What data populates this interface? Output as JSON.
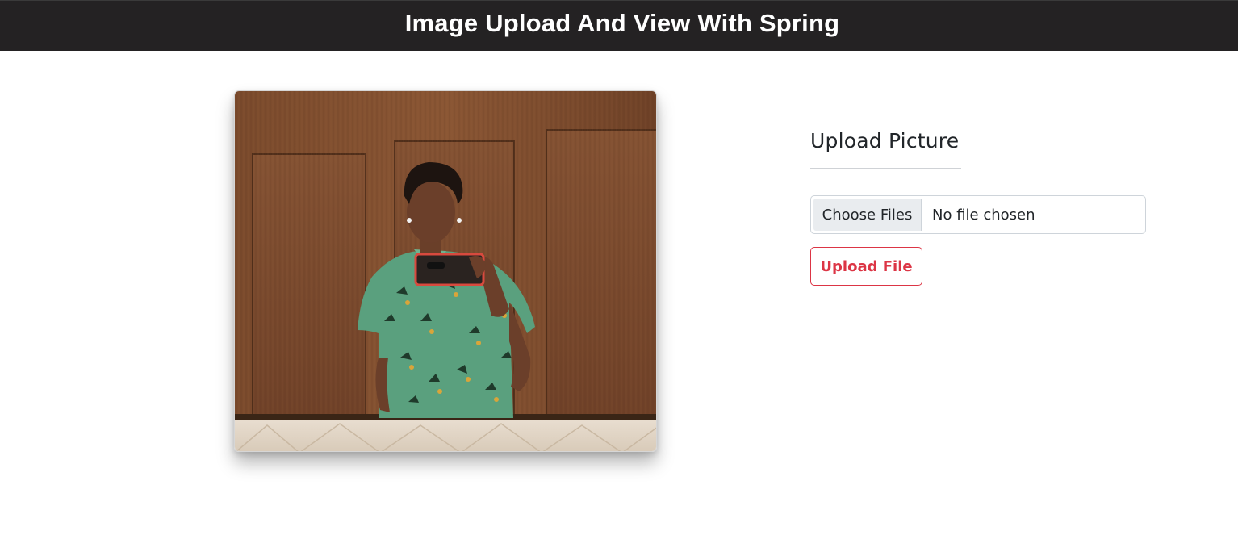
{
  "header": {
    "title": "Image Upload And View With Spring"
  },
  "photo": {
    "icon": "uploaded-photo"
  },
  "upload_panel": {
    "title": "Upload Picture",
    "choose_label": "Choose Files",
    "file_status": "No file chosen",
    "upload_label": "Upload File"
  },
  "colors": {
    "header_bg": "#242223",
    "accent_danger": "#dc3545",
    "text_dark": "#212529"
  }
}
